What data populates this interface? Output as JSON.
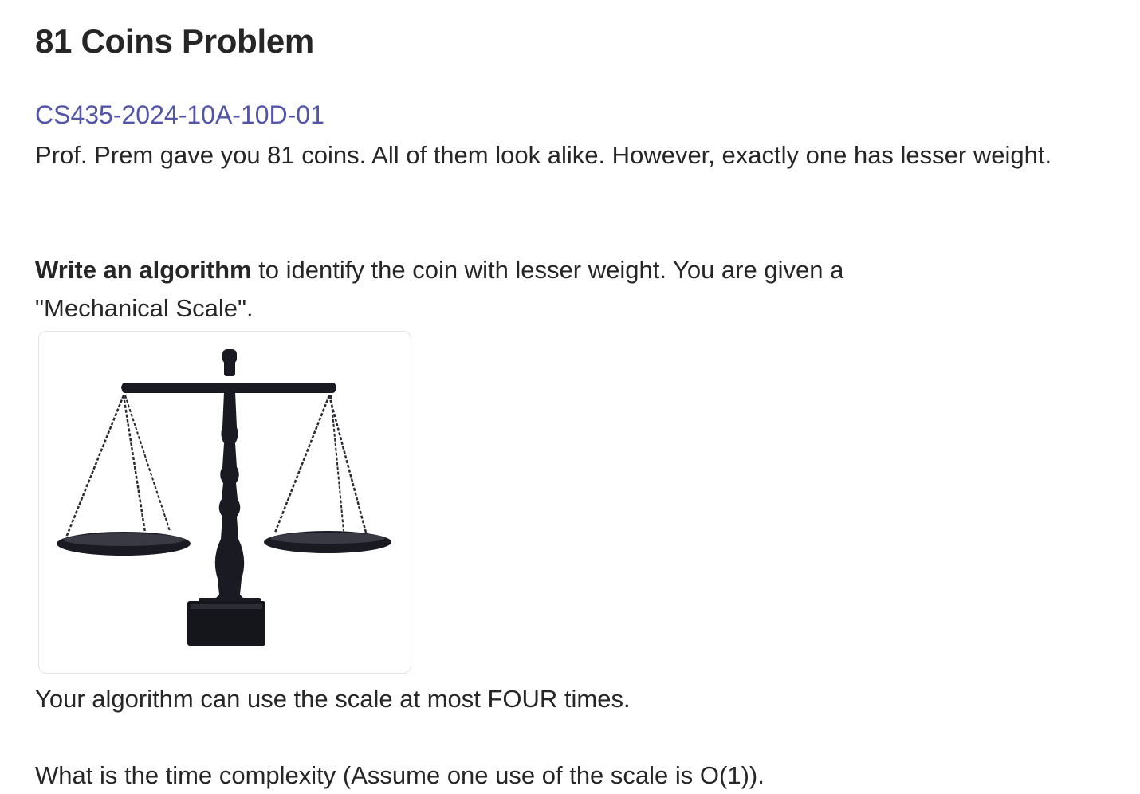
{
  "problem": {
    "title": "81 Coins Problem",
    "course_code": "CS435-2024-10A-10D-01",
    "paragraph_1": "Prof. Prem gave you 81 coins. All of them look alike. However, exactly one has lesser weight.",
    "paragraph_2_bold": "Write an algorithm",
    "paragraph_2_rest": " to identify the coin with lesser weight. You are given a \"Mechanical Scale\".",
    "image_icon": "balance-scale-icon",
    "paragraph_3": "Your algorithm can use the scale at most FOUR times.",
    "paragraph_4": "What is the time complexity (Assume one use of the scale is O(1))."
  },
  "colors": {
    "link": "#5356a8",
    "text": "#262626",
    "scale": "#1a1a22"
  }
}
